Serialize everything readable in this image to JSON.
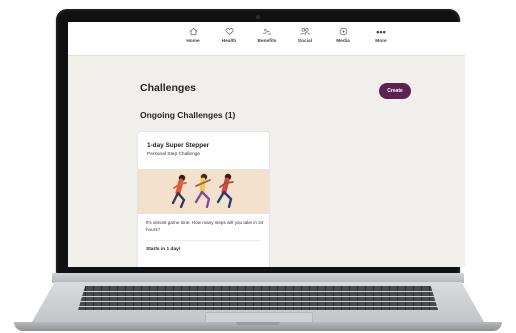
{
  "nav": {
    "items": [
      {
        "label": "Home",
        "icon": "home-icon"
      },
      {
        "label": "Health",
        "icon": "heart-icon"
      },
      {
        "label": "Benefits",
        "icon": "benefits-icon"
      },
      {
        "label": "Social",
        "icon": "social-icon"
      },
      {
        "label": "Media",
        "icon": "media-icon"
      },
      {
        "label": "More",
        "icon": "more-icon"
      }
    ]
  },
  "page": {
    "title": "Challenges",
    "create_label": "Create",
    "section_title": "Ongoing Challenges (1)"
  },
  "card": {
    "title": "1-day Super Stepper",
    "subtitle": "Personal Step Challenge",
    "description": "It's almost game time. How many steps will you take in 24 hours?",
    "start": "Starts in 1 day!"
  },
  "colors": {
    "accent": "#5a2350",
    "hero_bg": "#f3e0cd",
    "page_bg": "#f1efeb"
  }
}
